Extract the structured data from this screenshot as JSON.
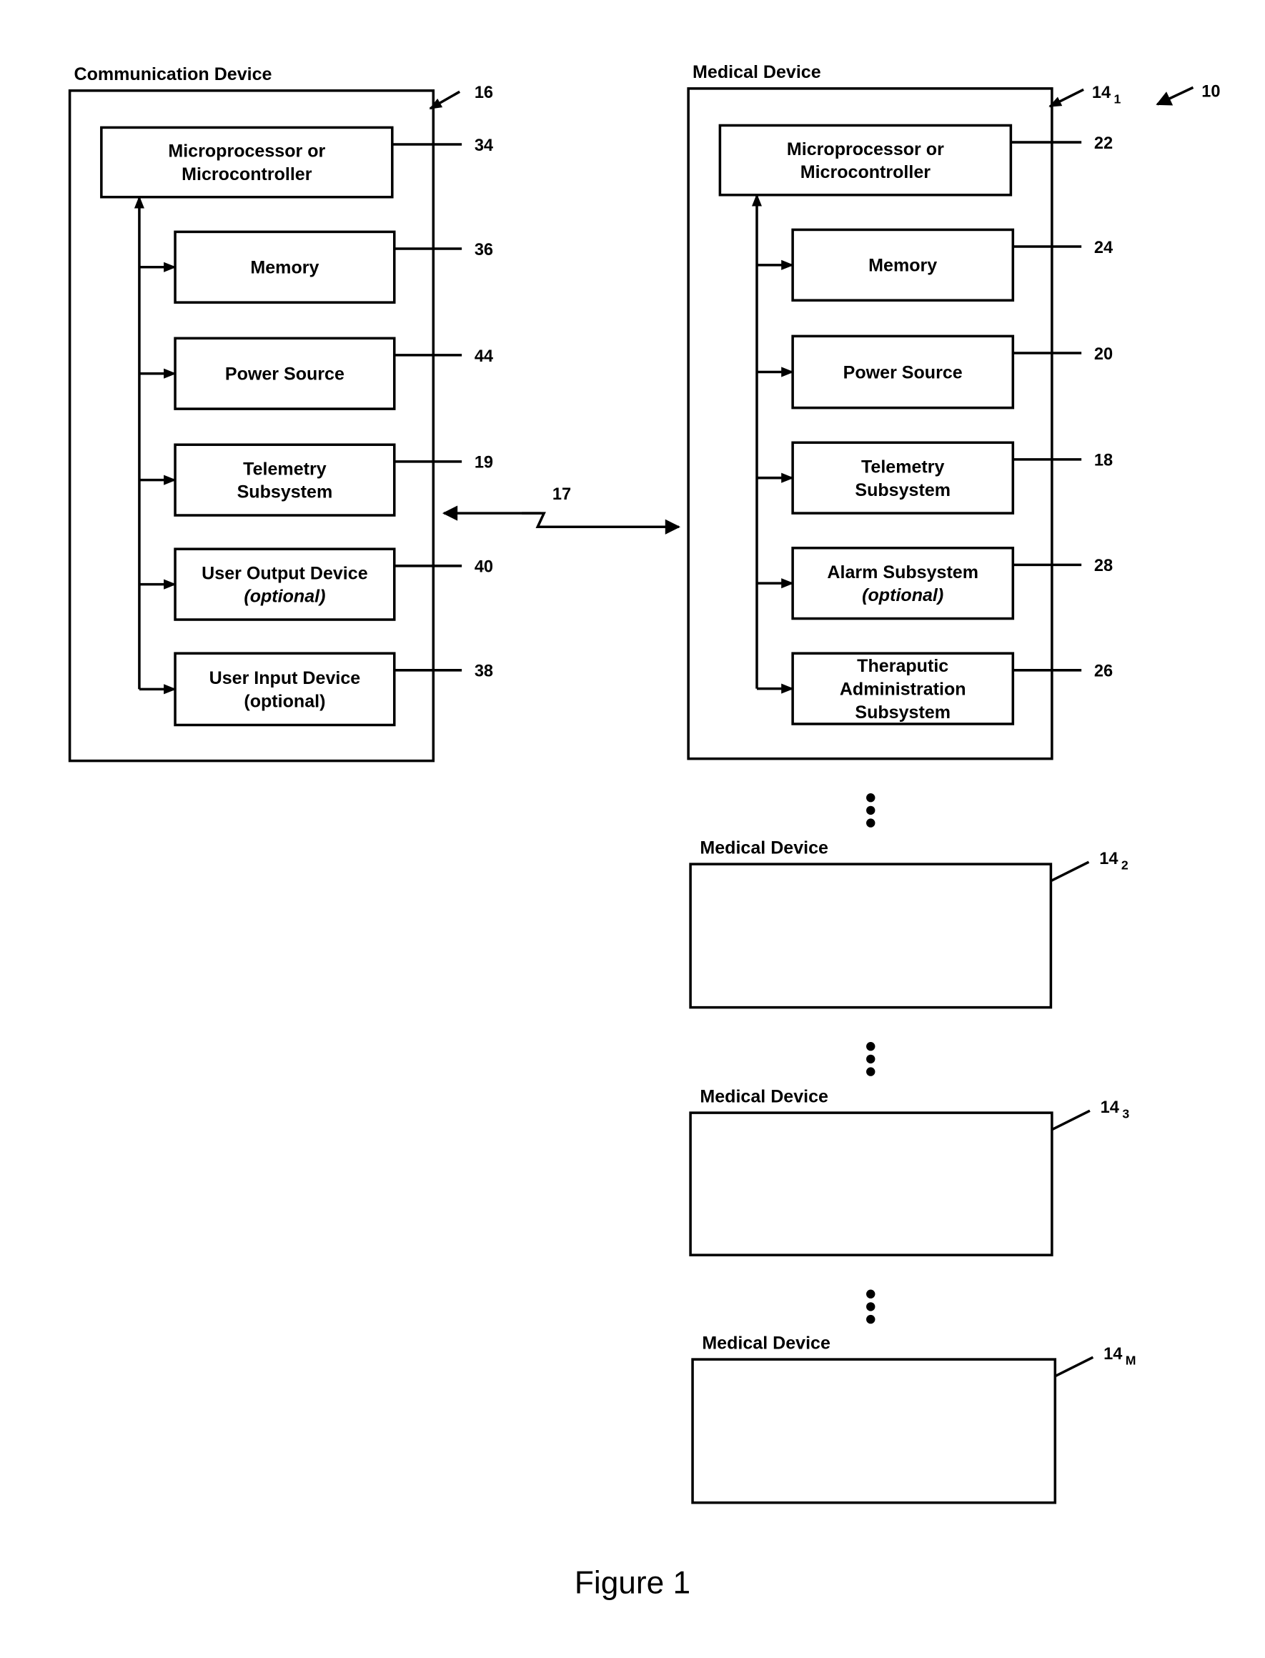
{
  "figure_caption": "Figure 1",
  "system_ref": "10",
  "link": {
    "ref": "17",
    "type": "bidirectional wireless"
  },
  "communication_device": {
    "title": "Communication Device",
    "ref": "16",
    "blocks": [
      {
        "lines": [
          "Microprocessor or",
          "Microcontroller"
        ],
        "ref": "34"
      },
      {
        "lines": [
          "Memory"
        ],
        "ref": "36"
      },
      {
        "lines": [
          "Power Source"
        ],
        "ref": "44"
      },
      {
        "lines": [
          "Telemetry",
          "Subsystem"
        ],
        "ref": "19"
      },
      {
        "lines": [
          "User Output Device",
          "(optional)"
        ],
        "ref": "40",
        "italic_line": 1
      },
      {
        "lines": [
          "User Input Device",
          "(optional)"
        ],
        "ref": "38"
      }
    ]
  },
  "medical_device_1": {
    "title": "Medical Device",
    "ref": "14",
    "ref_sub": "1",
    "blocks": [
      {
        "lines": [
          "Microprocessor or",
          "Microcontroller"
        ],
        "ref": "22"
      },
      {
        "lines": [
          "Memory"
        ],
        "ref": "24"
      },
      {
        "lines": [
          "Power Source"
        ],
        "ref": "20"
      },
      {
        "lines": [
          "Telemetry",
          "Subsystem"
        ],
        "ref": "18"
      },
      {
        "lines": [
          "Alarm Subsystem",
          "(optional)"
        ],
        "ref": "28",
        "italic_line": 1
      },
      {
        "lines": [
          "Theraputic",
          "Administration",
          "Subsystem"
        ],
        "ref": "26"
      }
    ]
  },
  "other_medical_devices": [
    {
      "title": "Medical Device",
      "ref": "14",
      "ref_sub": "2"
    },
    {
      "title": "Medical Device",
      "ref": "14",
      "ref_sub": "3"
    },
    {
      "title": "Medical Device",
      "ref": "14",
      "ref_sub": "M"
    }
  ],
  "ellipsis_icon": "vertical-ellipsis"
}
